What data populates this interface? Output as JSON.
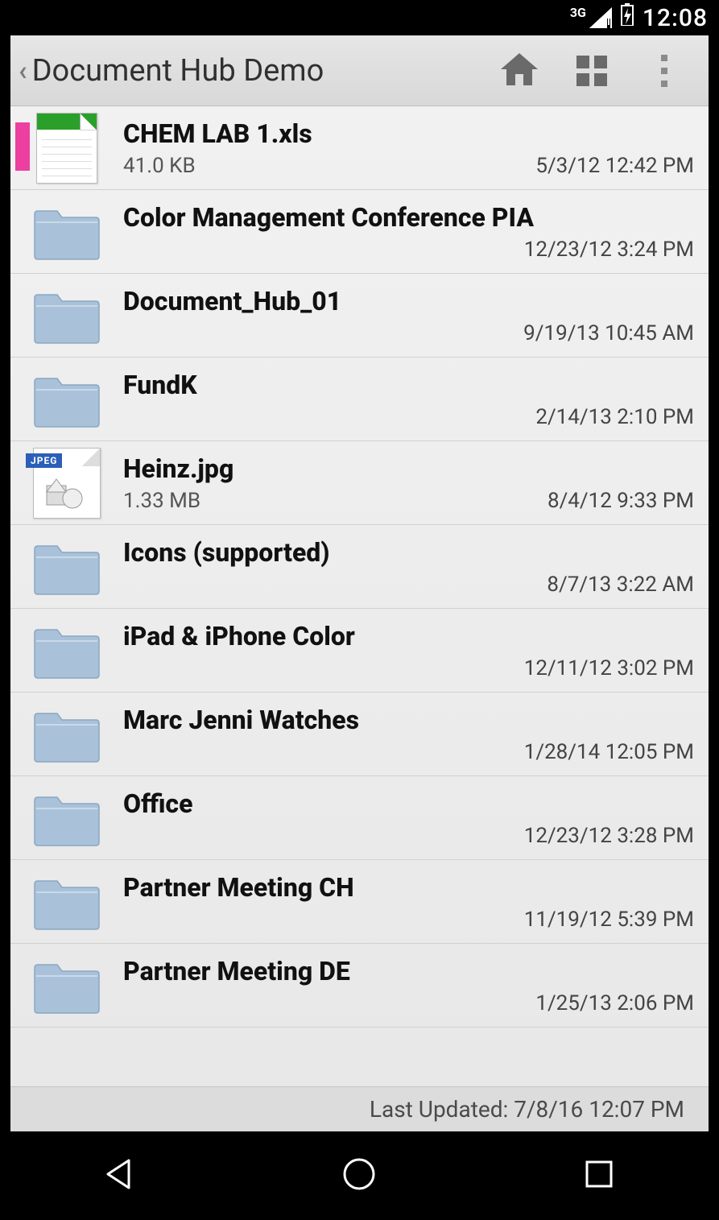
{
  "status": {
    "network": "3G",
    "clock": "12:08"
  },
  "header": {
    "title": "Document Hub Demo"
  },
  "files": [
    {
      "name": "CHEM LAB 1.xls",
      "size": "41.0 KB",
      "date": "5/3/12 12:42 PM",
      "type": "xls",
      "selected": true
    },
    {
      "name": "Color Management Conference PIA",
      "size": "",
      "date": "12/23/12 3:24 PM",
      "type": "folder",
      "selected": false
    },
    {
      "name": "Document_Hub_01",
      "size": "",
      "date": "9/19/13 10:45 AM",
      "type": "folder",
      "selected": false
    },
    {
      "name": "FundK",
      "size": "",
      "date": "2/14/13 2:10 PM",
      "type": "folder",
      "selected": false
    },
    {
      "name": "Heinz.jpg",
      "size": "1.33 MB",
      "date": "8/4/12 9:33 PM",
      "type": "jpg",
      "selected": false
    },
    {
      "name": "Icons (supported)",
      "size": "",
      "date": "8/7/13 3:22 AM",
      "type": "folder",
      "selected": false
    },
    {
      "name": "iPad & iPhone Color",
      "size": "",
      "date": "12/11/12 3:02 PM",
      "type": "folder",
      "selected": false
    },
    {
      "name": "Marc Jenni Watches",
      "size": "",
      "date": "1/28/14 12:05 PM",
      "type": "folder",
      "selected": false
    },
    {
      "name": "Office",
      "size": "",
      "date": "12/23/12 3:28 PM",
      "type": "folder",
      "selected": false
    },
    {
      "name": "Partner Meeting CH",
      "size": "",
      "date": "11/19/12 5:39 PM",
      "type": "folder",
      "selected": false
    },
    {
      "name": "Partner Meeting DE",
      "size": "",
      "date": "1/25/13 2:06 PM",
      "type": "folder",
      "selected": false
    }
  ],
  "footer": {
    "label": "Last Updated: 7/8/16 12:07 PM"
  }
}
